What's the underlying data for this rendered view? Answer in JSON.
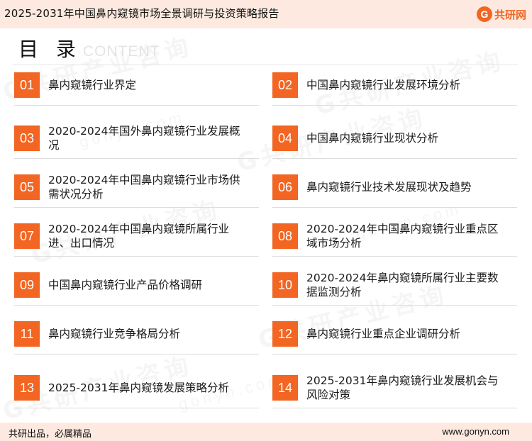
{
  "header": {
    "title": "2025-2031年中国鼻内窥镜市场全景调研与投资策略报告",
    "logo_mark": "G",
    "logo_text": "共研网"
  },
  "toc": {
    "heading": "目 录",
    "heading_sub": "CONTENT",
    "items": [
      {
        "num": "01",
        "label": "鼻内窥镜行业界定"
      },
      {
        "num": "02",
        "label": "中国鼻内窥镜行业发展环境分析"
      },
      {
        "num": "03",
        "label": "2020-2024年国外鼻内窥镜行业发展概况"
      },
      {
        "num": "04",
        "label": "中国鼻内窥镜行业现状分析"
      },
      {
        "num": "05",
        "label": "2020-2024年中国鼻内窥镜行业市场供需状况分析"
      },
      {
        "num": "06",
        "label": "鼻内窥镜行业技术发展现状及趋势"
      },
      {
        "num": "07",
        "label": "2020-2024年中国鼻内窥镜所属行业进、出口情况"
      },
      {
        "num": "08",
        "label": "2020-2024年中国鼻内窥镜行业重点区域市场分析"
      },
      {
        "num": "09",
        "label": "中国鼻内窥镜行业产品价格调研"
      },
      {
        "num": "10",
        "label": "2020-2024年鼻内窥镜所属行业主要数据监测分析"
      },
      {
        "num": "11",
        "label": "鼻内窥镜行业竞争格局分析"
      },
      {
        "num": "12",
        "label": "鼻内窥镜行业重点企业调研分析"
      },
      {
        "num": "13",
        "label": "2025-2031年鼻内窥镜发展策略分析"
      },
      {
        "num": "14",
        "label": "2025-2031年鼻内窥镜行业发展机会与风险对策"
      }
    ]
  },
  "watermark": {
    "text": "G共研产业咨询",
    "url": "gonyn.com"
  },
  "footer": {
    "left": "共研出品，必属精品",
    "right": "www.gonyn.com"
  },
  "colors": {
    "accent": "#f26522",
    "band": "#fde9df"
  }
}
